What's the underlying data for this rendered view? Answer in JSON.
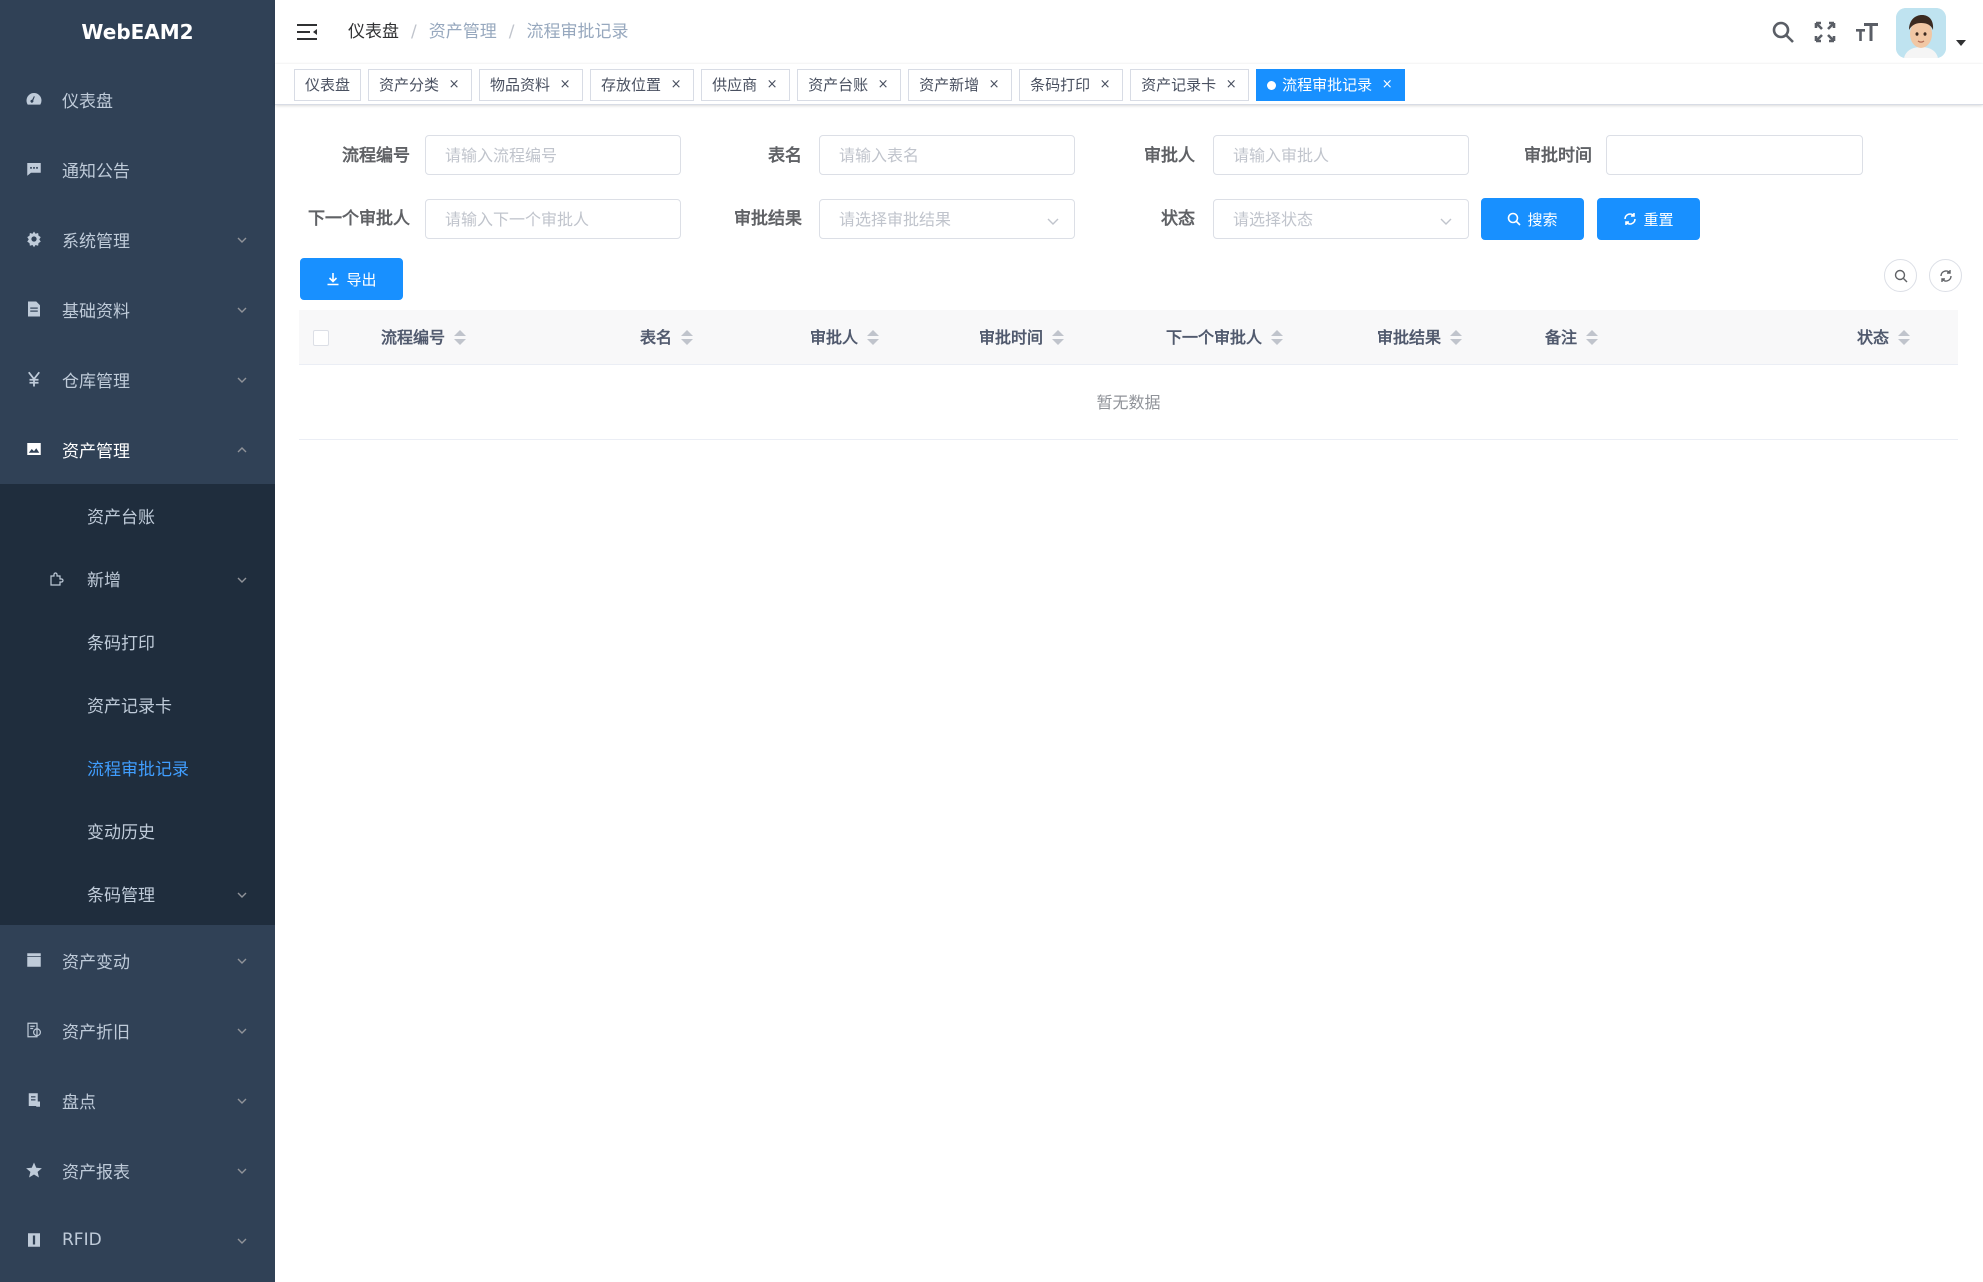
{
  "app": {
    "logo": "WebEAM2"
  },
  "sidebar": {
    "items": [
      {
        "label": "仪表盘"
      },
      {
        "label": "通知公告"
      },
      {
        "label": "系统管理"
      },
      {
        "label": "基础资料"
      },
      {
        "label": "仓库管理"
      },
      {
        "label": "资产管理"
      }
    ],
    "submenu": [
      {
        "label": "资产台账"
      },
      {
        "label": "新增"
      },
      {
        "label": "条码打印"
      },
      {
        "label": "资产记录卡"
      },
      {
        "label": "流程审批记录"
      },
      {
        "label": "变动历史"
      },
      {
        "label": "条码管理"
      }
    ],
    "items_after": [
      {
        "label": "资产变动"
      },
      {
        "label": "资产折旧"
      },
      {
        "label": "盘点"
      },
      {
        "label": "资产报表"
      },
      {
        "label": "RFID"
      }
    ]
  },
  "breadcrumb": [
    "仪表盘",
    "资产管理",
    "流程审批记录"
  ],
  "tags": [
    "仪表盘",
    "资产分类",
    "物品资料",
    "存放位置",
    "供应商",
    "资产台账",
    "资产新增",
    "条码打印",
    "资产记录卡",
    "流程审批记录"
  ],
  "tag_close": "×",
  "form": {
    "process_no": {
      "label": "流程编号",
      "placeholder": "请输入流程编号"
    },
    "table_name": {
      "label": "表名",
      "placeholder": "请输入表名"
    },
    "approver": {
      "label": "审批人",
      "placeholder": "请输入审批人"
    },
    "approve_time": {
      "label": "审批时间",
      "placeholder": ""
    },
    "next_approver": {
      "label": "下一个审批人",
      "placeholder": "请输入下一个审批人"
    },
    "result": {
      "label": "审批结果",
      "placeholder": "请选择审批结果"
    },
    "status": {
      "label": "状态",
      "placeholder": "请选择状态"
    },
    "search_label": "搜索",
    "reset_label": "重置"
  },
  "toolbar": {
    "export_label": "导出"
  },
  "table": {
    "columns": [
      "流程编号",
      "表名",
      "审批人",
      "审批时间",
      "下一个审批人",
      "审批结果",
      "备注",
      "状态"
    ],
    "empty_text": "暂无数据"
  },
  "colors": {
    "primary": "#1890ff",
    "sidebar_bg": "#304156",
    "submenu_bg": "#1f2d3d",
    "active_text": "#409eff"
  }
}
